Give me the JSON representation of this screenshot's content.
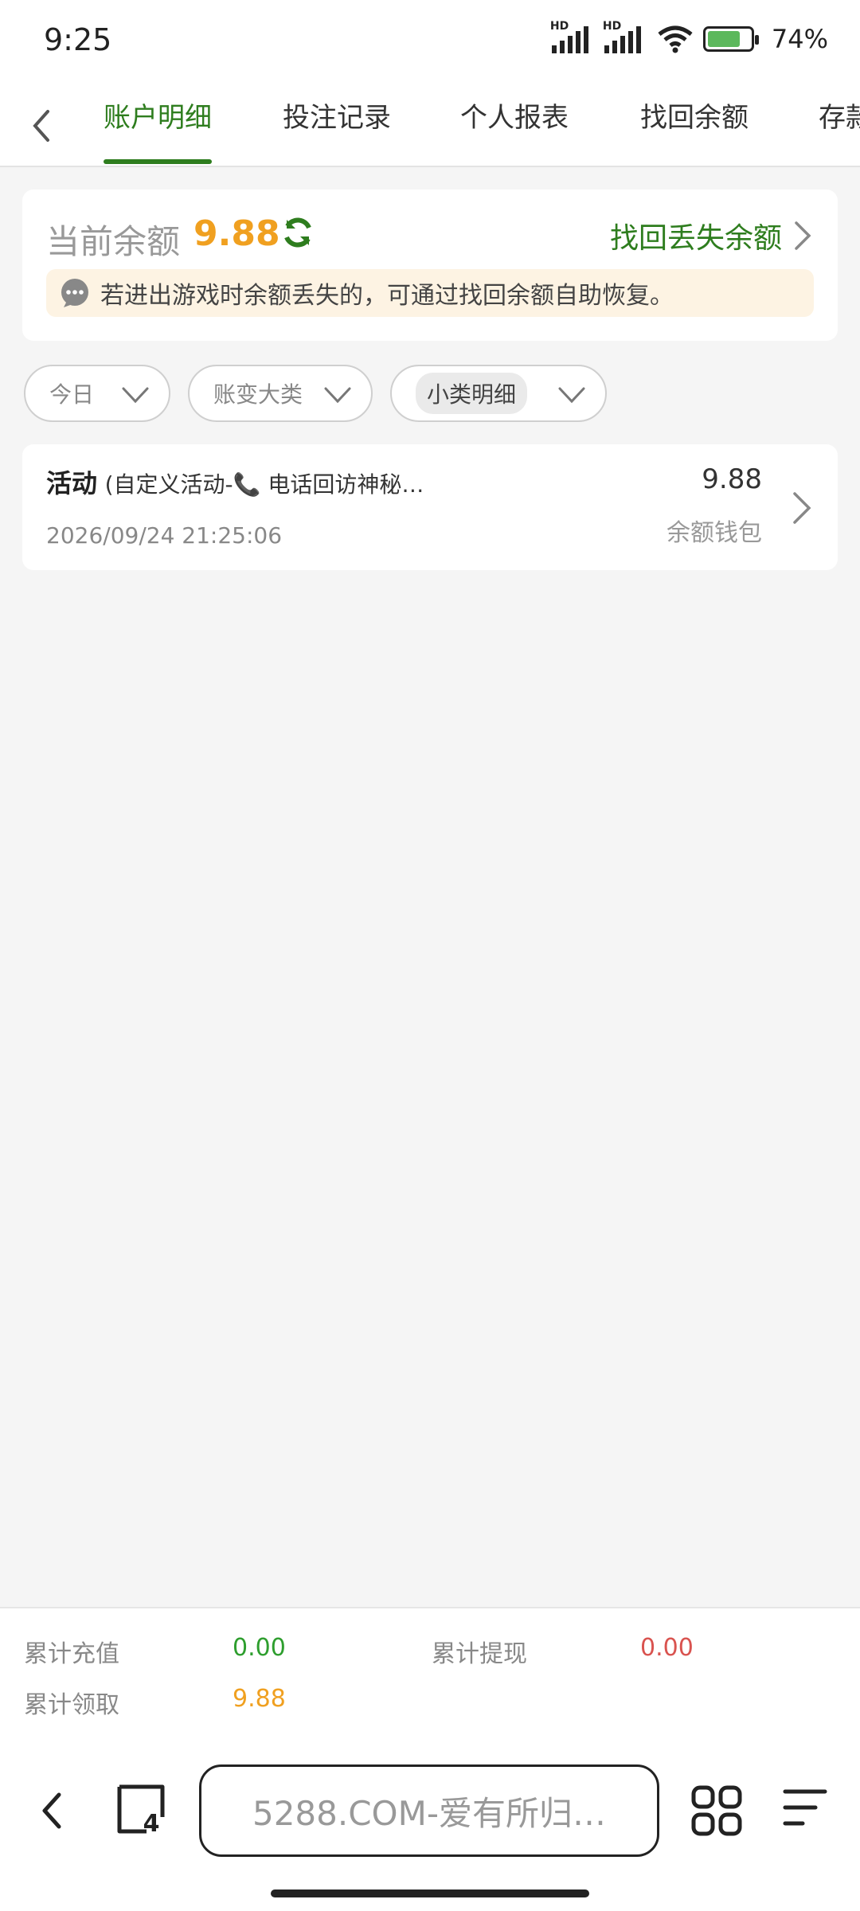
{
  "status_bar": {
    "time": "9:25",
    "battery_percent": "74%"
  },
  "tabs": [
    {
      "label": "账户明细",
      "active": true
    },
    {
      "label": "投注记录",
      "active": false
    },
    {
      "label": "个人报表",
      "active": false
    },
    {
      "label": "找回余额",
      "active": false
    },
    {
      "label": "存款",
      "active": false
    }
  ],
  "balance": {
    "label": "当前余额",
    "value": "9.88",
    "recover_link": "找回丢失余额",
    "notice": "若进出游戏时余额丢失的，可通过找回余额自助恢复。"
  },
  "filters": {
    "date": "今日",
    "category": "账变大类",
    "subcategory": "小类明细"
  },
  "records": [
    {
      "type": "活动",
      "detail": "(自定义活动-📞 电话回访神秘…",
      "amount": "9.88",
      "wallet": "余额钱包",
      "time": "2026/09/24 21:25:06"
    }
  ],
  "summary": {
    "recharge_label": "累计充值",
    "recharge_value": "0.00",
    "withdraw_label": "累计提现",
    "withdraw_value": "0.00",
    "claimed_label": "累计领取",
    "claimed_value": "9.88"
  },
  "browser": {
    "url_text": "5288.COM-爱有所归…",
    "tab_count": "4"
  },
  "colors": {
    "accent_green": "#2e7d1e",
    "amount_orange": "#f0a020",
    "value_green": "#2e9e2e",
    "value_red": "#d9534f"
  }
}
